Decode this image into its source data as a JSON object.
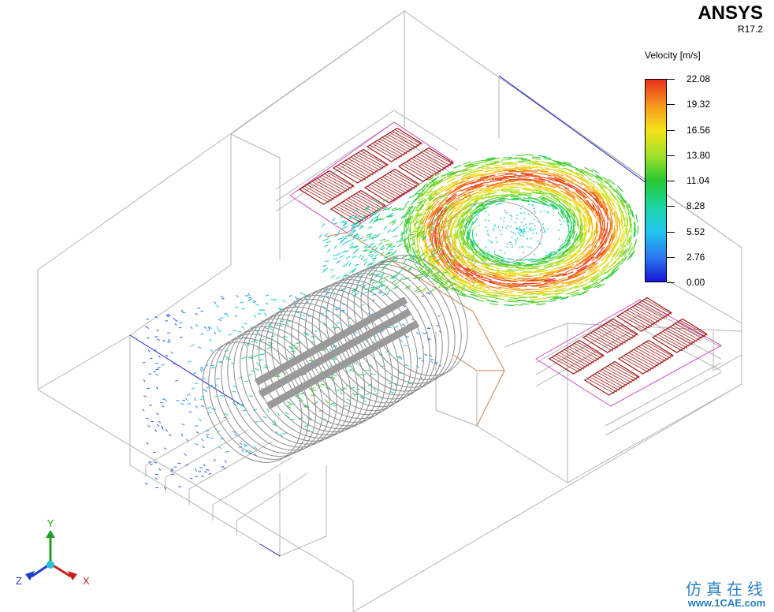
{
  "header": {
    "brand": "ANSYS",
    "version": "R17.2"
  },
  "legend": {
    "title": "Velocity [m/s]",
    "ticks": [
      "22.08",
      "19.32",
      "16.56",
      "13.80",
      "11.04",
      "8.28",
      "5.52",
      "2.76",
      "0.00"
    ],
    "colors": [
      "#e8301c",
      "#f79a1d",
      "#f5e21a",
      "#9ee02a",
      "#27c832",
      "#1ad6a6",
      "#22c6ee",
      "#2a78ee",
      "#1515d8"
    ]
  },
  "axes": {
    "x": "X",
    "y": "Y",
    "z": "Z",
    "x_color": "#c81e1e",
    "y_color": "#1ea01e",
    "z_color": "#1e3cc8"
  },
  "watermark": {
    "chinese": "仿真在线",
    "url": "www.1CAE.com"
  },
  "colors": {
    "wireframe": "#b4b4b4",
    "outline_blue": "#2020c8",
    "heater": "#a01818",
    "frame_magenta": "#d050c8",
    "duct_orange": "#d08040",
    "rotor": "#8c8c8c"
  }
}
